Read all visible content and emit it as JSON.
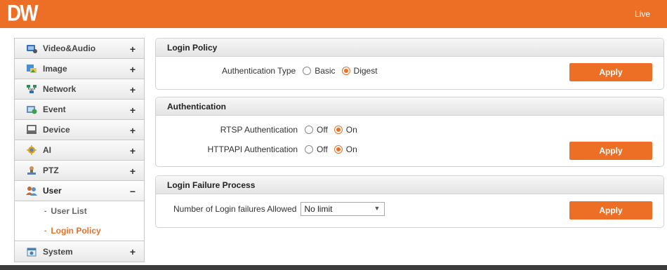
{
  "header": {
    "logo": "DW",
    "live_label": "Live"
  },
  "sidebar": {
    "items": [
      {
        "label": "Video&Audio",
        "toggle": "+",
        "icon": "video-audio-icon",
        "color": "#3a6fb5"
      },
      {
        "label": "Image",
        "toggle": "+",
        "icon": "image-icon",
        "color": "#4a90d0"
      },
      {
        "label": "Network",
        "toggle": "+",
        "icon": "network-icon",
        "color": "#2f8f4f"
      },
      {
        "label": "Event",
        "toggle": "+",
        "icon": "event-icon",
        "color": "#3aa04a"
      },
      {
        "label": "Device",
        "toggle": "+",
        "icon": "device-icon",
        "color": "#555555"
      },
      {
        "label": "AI",
        "toggle": "+",
        "icon": "ai-icon",
        "color": "#d9a020"
      },
      {
        "label": "PTZ",
        "toggle": "+",
        "icon": "ptz-icon",
        "color": "#8a6a3a"
      },
      {
        "label": "User",
        "toggle": "−",
        "icon": "user-icon",
        "color": "#c46a2a"
      },
      {
        "label": "System",
        "toggle": "+",
        "icon": "system-icon",
        "color": "#4a7fb0"
      }
    ],
    "user_submenu": [
      {
        "label": "User List",
        "bullet": "-"
      },
      {
        "label": "Login Policy",
        "bullet": "-"
      }
    ]
  },
  "login_policy": {
    "title": "Login Policy",
    "auth_type_label": "Authentication Type",
    "options": [
      "Basic",
      "Digest"
    ],
    "selected": "Digest",
    "apply_label": "Apply"
  },
  "authentication": {
    "title": "Authentication",
    "rtsp_label": "RTSP Authentication",
    "httpapi_label": "HTTPAPI Authentication",
    "off_label": "Off",
    "on_label": "On",
    "rtsp_selected": "On",
    "httpapi_selected": "On",
    "apply_label": "Apply"
  },
  "login_failure": {
    "title": "Login Failure Process",
    "failures_label": "Number of Login failures Allowed",
    "failures_value": "No limit",
    "apply_label": "Apply"
  },
  "colors": {
    "accent": "#ec6f25"
  }
}
